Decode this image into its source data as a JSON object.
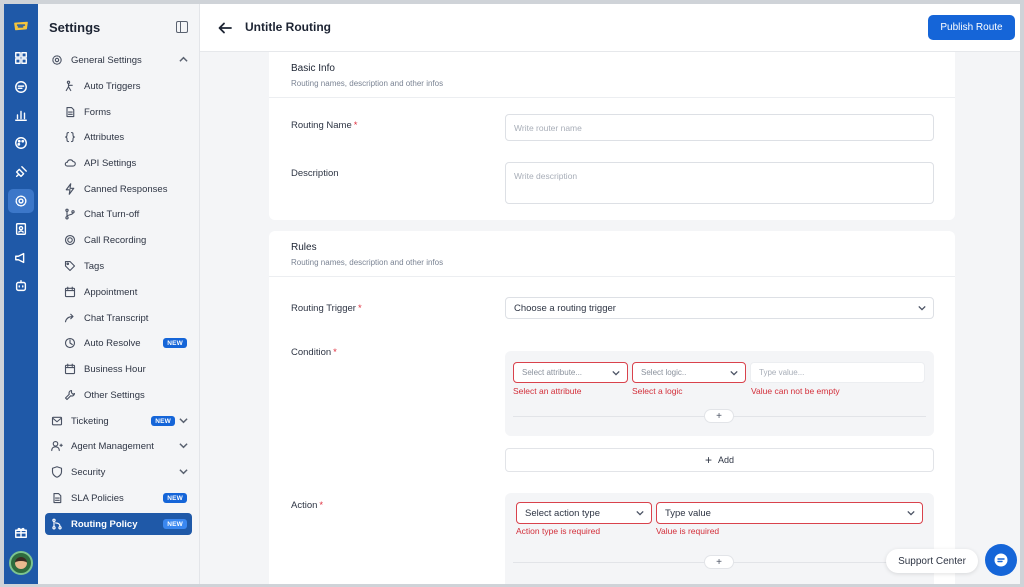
{
  "sidebar": {
    "title": "Settings",
    "groups": {
      "general": "General Settings",
      "ticketing": "Ticketing",
      "agent": "Agent Management",
      "security": "Security",
      "sla": "SLA Policies",
      "routing": "Routing Policy"
    },
    "items": [
      {
        "label": "Auto Triggers",
        "icon": "auto-triggers-icon"
      },
      {
        "label": "Forms",
        "icon": "forms-icon"
      },
      {
        "label": "Attributes",
        "icon": "braces-icon"
      },
      {
        "label": "API Settings",
        "icon": "cloud-icon"
      },
      {
        "label": "Canned Responses",
        "icon": "lightning-icon"
      },
      {
        "label": "Chat Turn-off",
        "icon": "git-branch-icon"
      },
      {
        "label": "Call Recording",
        "icon": "record-icon"
      },
      {
        "label": "Tags",
        "icon": "tag-icon"
      },
      {
        "label": "Appointment",
        "icon": "calendar-icon"
      },
      {
        "label": "Chat Transcript",
        "icon": "share-arrow-icon"
      },
      {
        "label": "Auto Resolve",
        "icon": "clock-icon",
        "badge": "NEW"
      },
      {
        "label": "Business Hour",
        "icon": "calendar-icon"
      },
      {
        "label": "Other Settings",
        "icon": "wrench-icon"
      }
    ],
    "badge_new": "NEW"
  },
  "header": {
    "title": "Untitle Routing",
    "publish_label": "Publish Route"
  },
  "basic_info": {
    "title": "Basic Info",
    "subtitle": "Routing names, description and other infos",
    "routing_name_label": "Routing Name",
    "routing_name_placeholder": "Write router name",
    "description_label": "Description",
    "description_placeholder": "Write description",
    "required_mark": "*"
  },
  "rules": {
    "title": "Rules",
    "subtitle": "Routing names, description and other infos",
    "trigger_label": "Routing Trigger",
    "trigger_value": "Choose a routing trigger",
    "condition_label": "Condition",
    "attribute_placeholder": "Select attribute...",
    "logic_placeholder": "Select logic..",
    "value_placeholder": "Type value...",
    "attribute_error": "Select an attribute",
    "logic_error": "Select a logic",
    "value_error": "Value can not be empty",
    "add_label": "Add",
    "action_label": "Action",
    "action_type_placeholder": "Select action type",
    "action_value_placeholder": "Type value",
    "action_type_error": "Action type is required",
    "action_value_error": "Value is required",
    "plus": "+"
  },
  "support": {
    "label": "Support Center"
  },
  "colors": {
    "rail": "#1f59a8",
    "primary": "#1565d8",
    "error": "#d32f3a"
  }
}
